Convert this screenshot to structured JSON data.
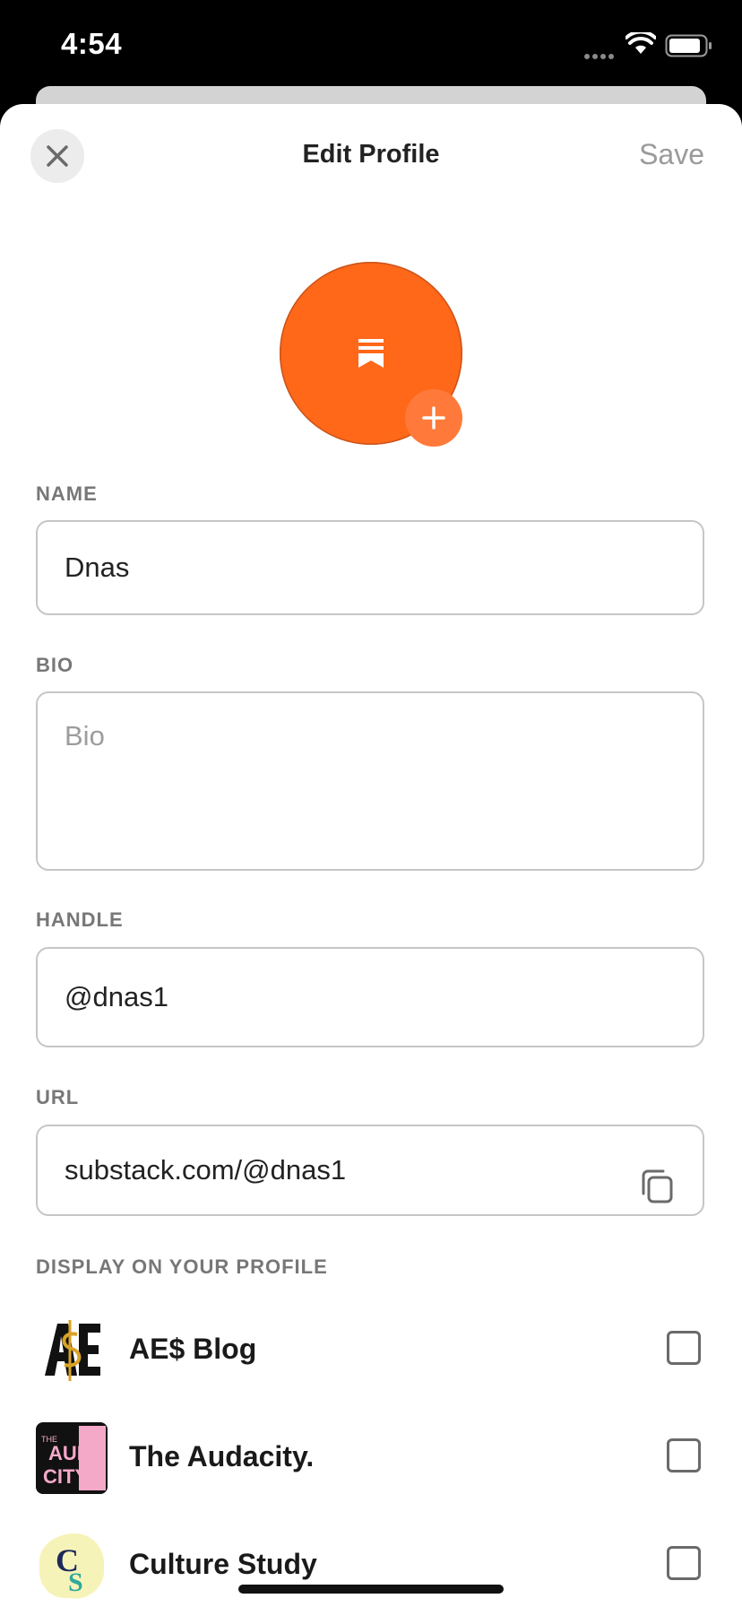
{
  "status_bar": {
    "time": "4:54"
  },
  "header": {
    "title": "Edit Profile",
    "save_label": "Save"
  },
  "colors": {
    "accent": "#ff6719",
    "label": "#777777",
    "border": "#c6c6c6"
  },
  "form": {
    "name": {
      "label": "NAME",
      "value": "Dnas"
    },
    "bio": {
      "label": "BIO",
      "placeholder": "Bio"
    },
    "handle": {
      "label": "HANDLE",
      "value": "@dnas1"
    },
    "url": {
      "label": "URL",
      "value": "substack.com/@dnas1"
    }
  },
  "display_section": {
    "label": "DISPLAY ON YOUR PROFILE",
    "publications": [
      {
        "name": "AE$ Blog",
        "checked": false
      },
      {
        "name": "The Audacity.",
        "checked": false
      },
      {
        "name": "Culture Study",
        "checked": false
      }
    ]
  },
  "logos": {
    "audacity_text_top": "AUDA",
    "audacity_text_bottom": "CITY",
    "audacity_text_small": "THE",
    "culture_c": "C",
    "culture_s": "S"
  }
}
